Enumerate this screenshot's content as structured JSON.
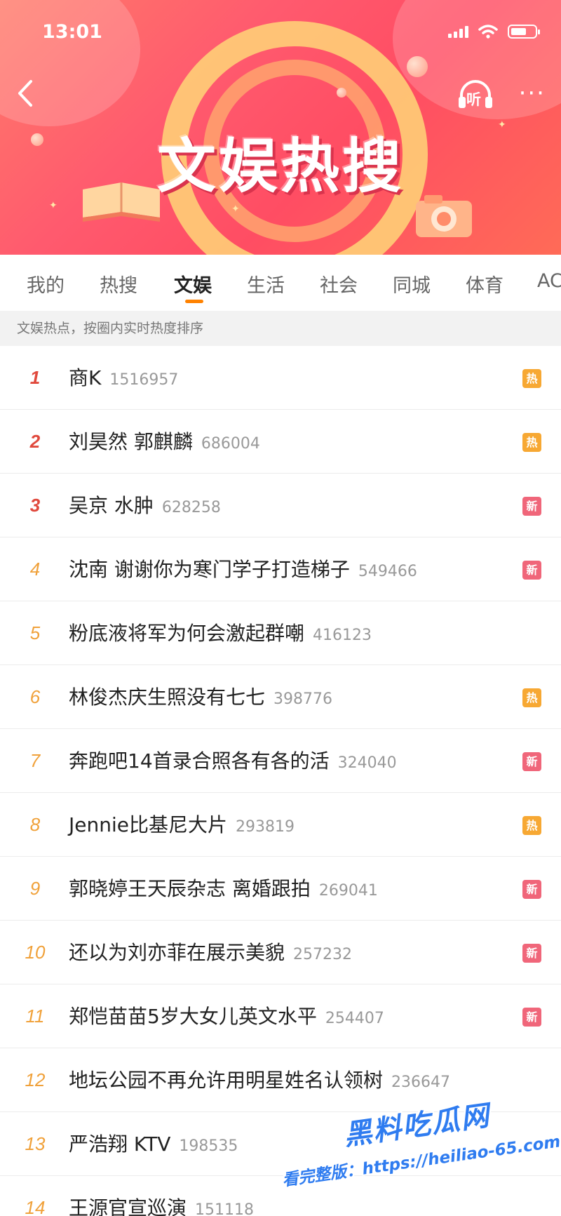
{
  "status_bar": {
    "time": "13:01"
  },
  "banner": {
    "title": "文娱热搜",
    "listen_label": "听",
    "more_label": "···",
    "back_label": "‹"
  },
  "tabs": [
    {
      "label": "我的",
      "active": false
    },
    {
      "label": "热搜",
      "active": false
    },
    {
      "label": "文娱",
      "active": true
    },
    {
      "label": "生活",
      "active": false
    },
    {
      "label": "社会",
      "active": false
    },
    {
      "label": "同城",
      "active": false
    },
    {
      "label": "体育",
      "active": false
    },
    {
      "label": "AC",
      "active": false
    }
  ],
  "hint": "文娱热点，按圈内实时热度排序",
  "badges": {
    "hot": "热",
    "new": "新"
  },
  "list": [
    {
      "rank": "1",
      "title": "商K",
      "count": "1516957",
      "badge": "hot"
    },
    {
      "rank": "2",
      "title": "刘昊然 郭麒麟",
      "count": "686004",
      "badge": "hot"
    },
    {
      "rank": "3",
      "title": "吴京 水肿",
      "count": "628258",
      "badge": "new"
    },
    {
      "rank": "4",
      "title": "沈南 谢谢你为寒门学子打造梯子",
      "count": "549466",
      "badge": "new"
    },
    {
      "rank": "5",
      "title": "粉底液将军为何会激起群嘲",
      "count": "416123",
      "badge": ""
    },
    {
      "rank": "6",
      "title": "林俊杰庆生照没有七七",
      "count": "398776",
      "badge": "hot"
    },
    {
      "rank": "7",
      "title": "奔跑吧14首录合照各有各的活",
      "count": "324040",
      "badge": "new"
    },
    {
      "rank": "8",
      "title": "Jennie比基尼大片",
      "count": "293819",
      "badge": "hot"
    },
    {
      "rank": "9",
      "title": "郭晓婷王天辰杂志 离婚跟拍",
      "count": "269041",
      "badge": "new"
    },
    {
      "rank": "10",
      "title": "还以为刘亦菲在展示美貌",
      "count": "257232",
      "badge": "new"
    },
    {
      "rank": "11",
      "title": "郑恺苗苗5岁大女儿英文水平",
      "count": "254407",
      "badge": "new"
    },
    {
      "rank": "12",
      "title": "地坛公园不再允许用明星姓名认领树",
      "count": "236647",
      "badge": ""
    },
    {
      "rank": "13",
      "title": "严浩翔 KTV",
      "count": "198535",
      "badge": ""
    },
    {
      "rank": "14",
      "title": "王源官宣巡演",
      "count": "151118",
      "badge": ""
    }
  ],
  "watermark": {
    "line1": "黑料吃瓜网",
    "line2": "看完整版：https://heiliao-65.com"
  },
  "colors": {
    "accent": "#ff8200",
    "rank_top": "#e0493d",
    "rank_mid": "#f0a13a",
    "badge_hot": "#f7a833",
    "badge_new": "#f0667a"
  }
}
